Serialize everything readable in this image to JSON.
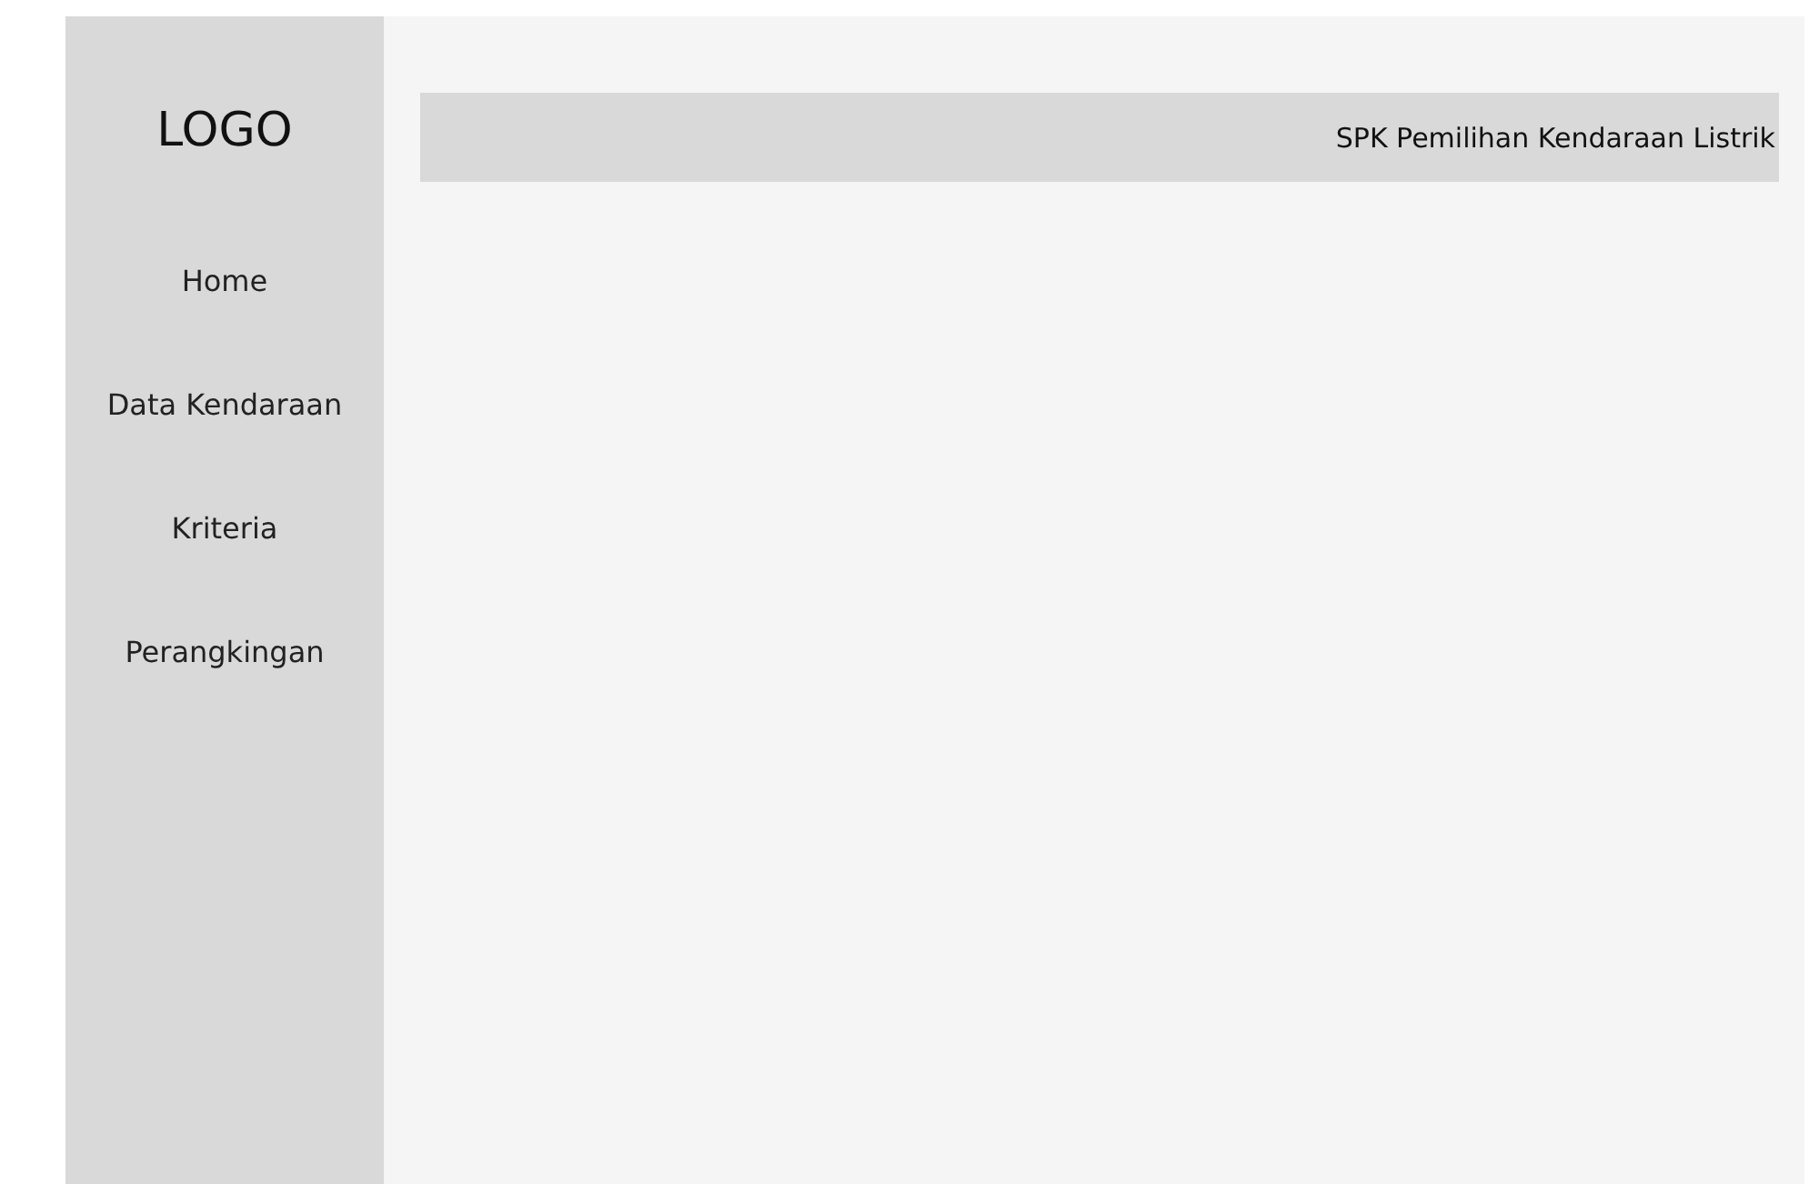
{
  "sidebar": {
    "logo": "LOGO",
    "items": [
      {
        "label": "Home"
      },
      {
        "label": "Data Kendaraan"
      },
      {
        "label": "Kriteria"
      },
      {
        "label": "Perangkingan"
      }
    ]
  },
  "header": {
    "title": "SPK Pemilihan Kendaraan Listrik"
  }
}
